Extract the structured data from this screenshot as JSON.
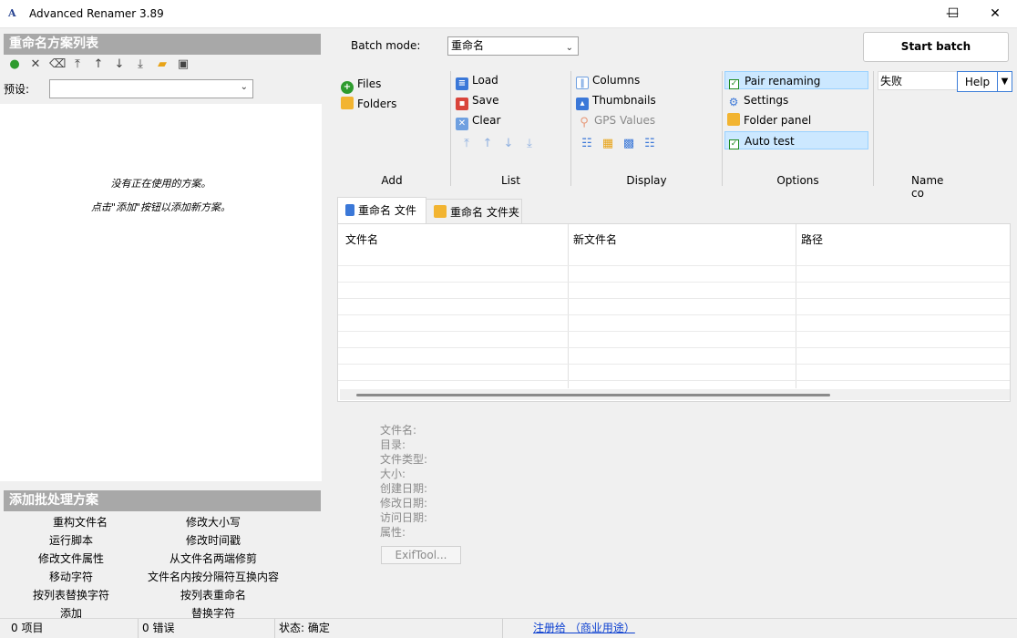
{
  "window": {
    "title": "Advanced Renamer 3.89",
    "icon_text": "A",
    "minimize": "—",
    "maximize": "☐",
    "close": "✕"
  },
  "left_panel": {
    "header": "重命名方案列表",
    "preset_label": "预设:",
    "preset_value": "",
    "empty_line1": "没有正在使用的方案。",
    "empty_line2": "点击\"添加\"按钮以添加新方案。",
    "batch_header": "添加批处理方案",
    "batch_items": [
      "重构文件名",
      "修改大小写",
      "运行脚本",
      "修改时间戳",
      "修改文件属性",
      "从文件名两端修剪",
      "移动字符",
      "文件名内按分隔符互换内容",
      "按列表替换字符",
      "按列表重命名",
      "添加",
      "替换字符"
    ]
  },
  "ribbon": {
    "batch_mode_label": "Batch mode:",
    "batch_mode_value": "重命名",
    "start_batch": "Start batch",
    "add": {
      "label": "Add",
      "files": "Files",
      "folders": "Folders"
    },
    "list": {
      "label": "List",
      "load": "Load",
      "save": "Save",
      "clear": "Clear"
    },
    "display": {
      "label": "Display",
      "columns": "Columns",
      "thumbnails": "Thumbnails",
      "gps_values": "GPS Values"
    },
    "options": {
      "label": "Options",
      "pair_renaming": "Pair renaming",
      "settings": "Settings",
      "folder_panel": "Folder panel",
      "auto_test": "Auto test"
    },
    "name_col": {
      "label": "Name co",
      "value": "失败",
      "help": "Help"
    }
  },
  "tabs": [
    {
      "label": "重命名 文件"
    },
    {
      "label": "重命名 文件夹"
    }
  ],
  "file_table": {
    "columns": [
      "文件名",
      "新文件名",
      "路径"
    ]
  },
  "details": {
    "labels": [
      "文件名:",
      "目录:",
      "文件类型:",
      "大小:",
      "创建日期:",
      "修改日期:",
      "访问日期:",
      "属性:"
    ],
    "exiftool": "ExifTool..."
  },
  "status": {
    "items": "0 项目",
    "errors": "0 错误",
    "state": "状态: 确定",
    "register": "注册给 （商业用途）"
  },
  "colors": {
    "accent_selected": "#cce8ff",
    "header_gray": "#a8a8a8",
    "link": "#0b3fd0"
  }
}
